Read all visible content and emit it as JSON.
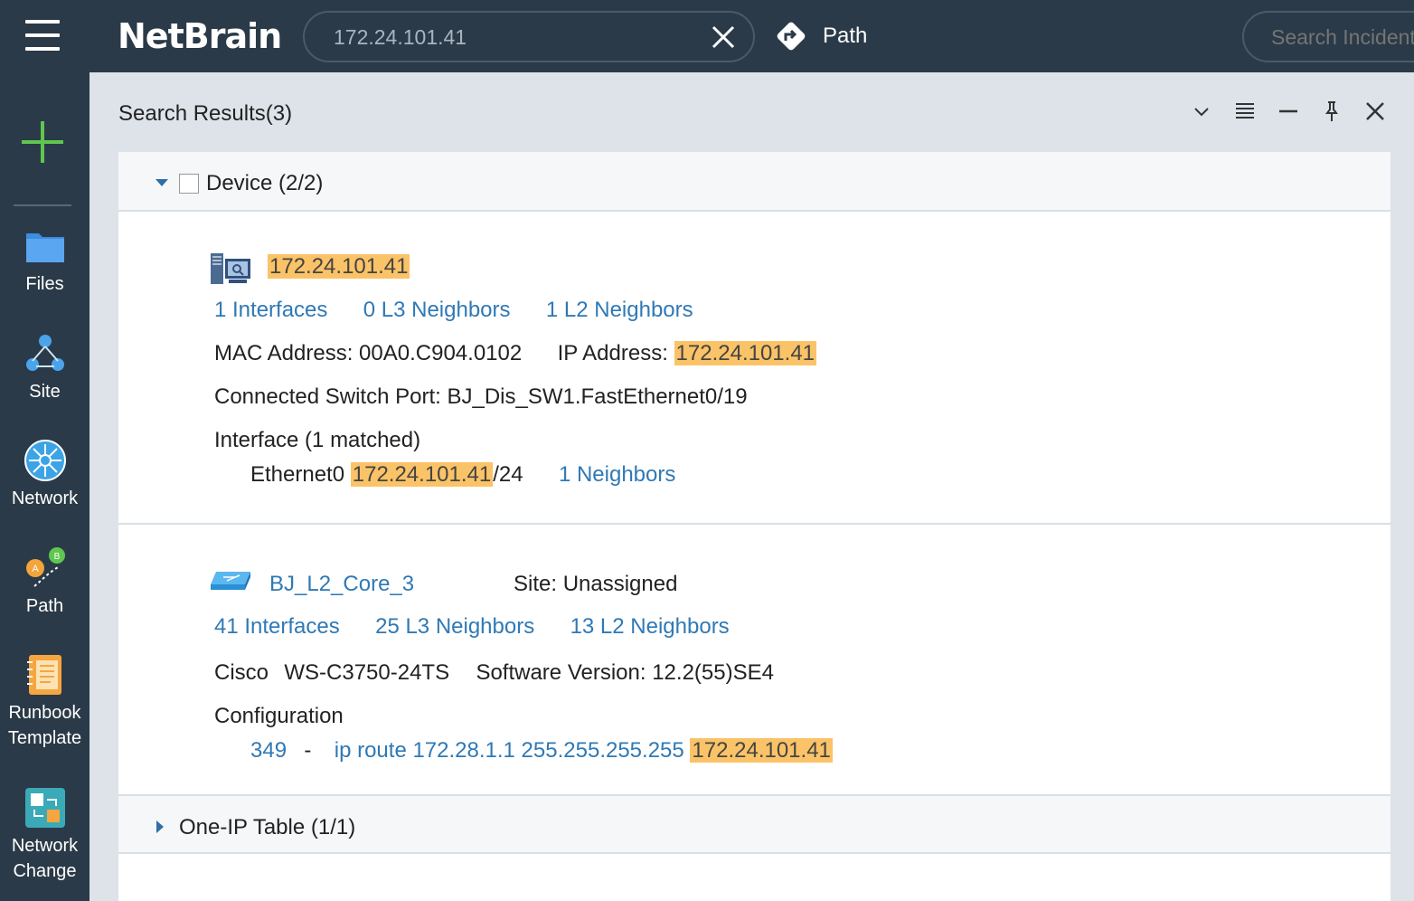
{
  "topbar": {
    "logo": "NetBrain",
    "search_value": "172.24.101.41",
    "path_label": "Path",
    "incident_placeholder": "Search Incident"
  },
  "sidebar": {
    "items": [
      {
        "label": "Files",
        "icon": "folder-icon"
      },
      {
        "label": "Site",
        "icon": "site-cloud-icon"
      },
      {
        "label": "Network",
        "icon": "network-icon"
      },
      {
        "label": "Path",
        "icon": "path-ab-icon"
      },
      {
        "label_line1": "Runbook",
        "label_line2": "Template",
        "icon": "runbook-icon"
      },
      {
        "label_line1": "Network",
        "label_line2": "Change",
        "icon": "network-change-icon"
      }
    ]
  },
  "panel": {
    "title": "Search Results(3)"
  },
  "device_group": {
    "label": "Device (2/2)",
    "device1": {
      "name": "172.24.101.41",
      "interfaces": "1 Interfaces",
      "l3": "0 L3 Neighbors",
      "l2": "1 L2 Neighbors",
      "mac_label": "MAC Address: 00A0.C904.0102",
      "ip_label": "IP Address:",
      "ip_value": "172.24.101.41",
      "switch_port": "Connected Switch Port: BJ_Dis_SW1.FastEthernet0/19",
      "interface_header": "Interface (1 matched)",
      "iface_name": "Ethernet0",
      "iface_ip": "172.24.101.41",
      "iface_mask": "/24",
      "iface_neighbors": "1 Neighbors"
    },
    "device2": {
      "name": "BJ_L2_Core_3",
      "site": "Site: Unassigned",
      "interfaces": "41 Interfaces",
      "l3": "25 L3 Neighbors",
      "l2": "13 L2 Neighbors",
      "vendor": "Cisco",
      "model": "WS-C3750-24TS",
      "software": "Software Version: 12.2(55)SE4",
      "config_header": "Configuration",
      "config_line": "349",
      "config_dash": "-",
      "config_text": "ip route 172.28.1.1 255.255.255.255",
      "config_ip": "172.24.101.41"
    }
  },
  "oneip_group": {
    "label": "One-IP Table (1/1)"
  },
  "colors": {
    "topbar_bg": "#2b3a48",
    "link": "#2f79b5",
    "highlight": "#fbc367",
    "accent_plus": "#5fc64f"
  }
}
